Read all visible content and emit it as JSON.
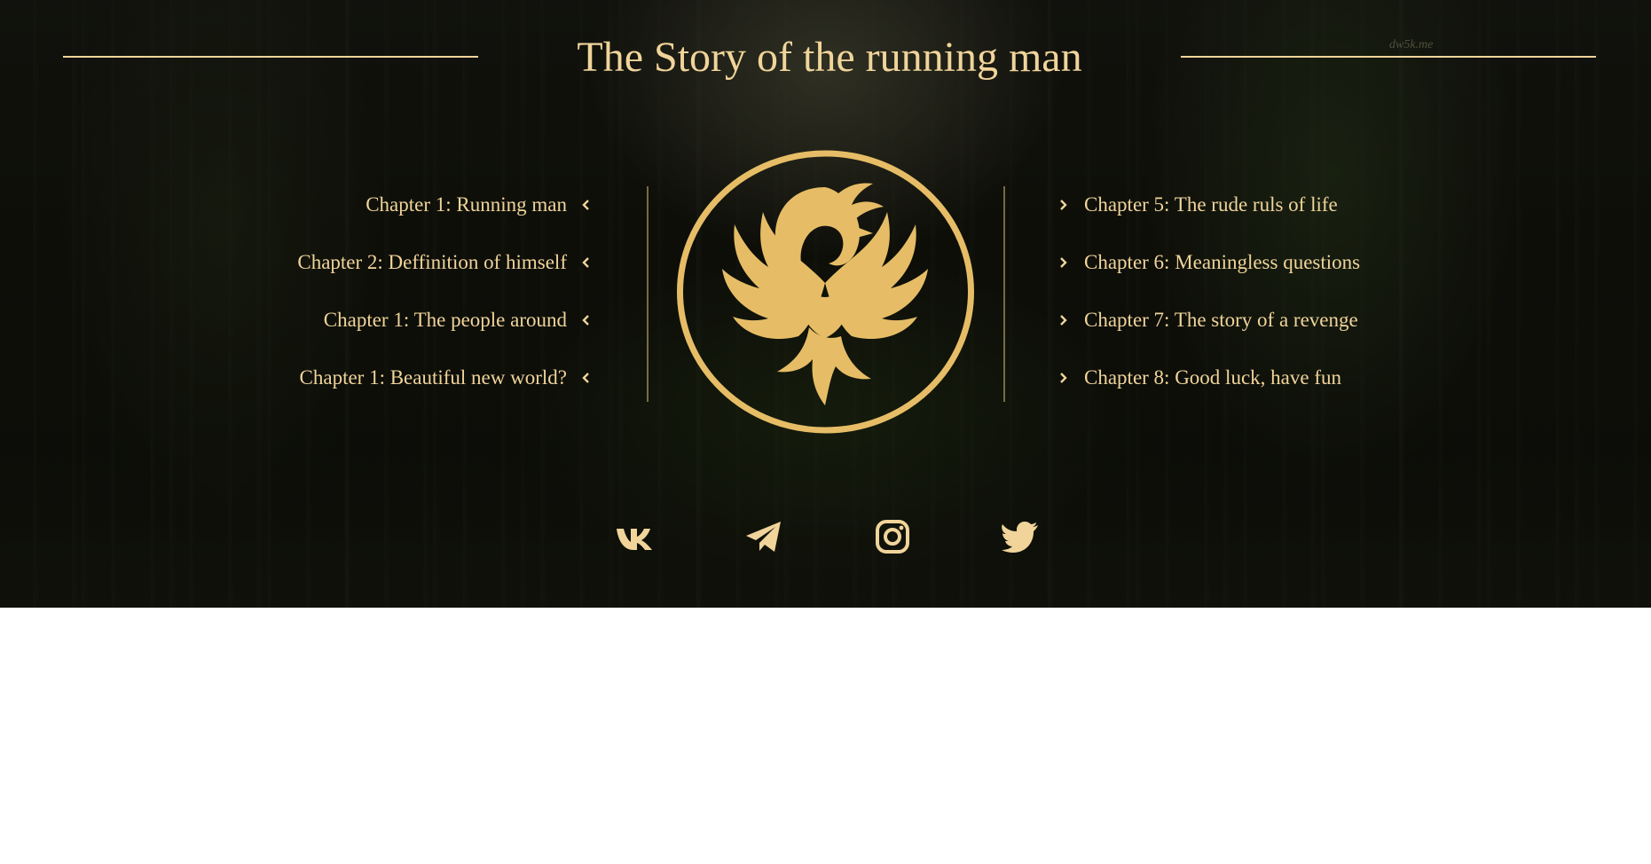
{
  "header": {
    "title": "The Story of the running man",
    "watermark": "dw5k.me"
  },
  "chapters_left": [
    {
      "label": "Chapter 1: Running man"
    },
    {
      "label": "Chapter 2: Deffinition of himself"
    },
    {
      "label": "Chapter 1: The people around"
    },
    {
      "label": "Chapter 1: Beautiful new world?"
    }
  ],
  "chapters_right": [
    {
      "label": "Chapter 5: The rude ruls of life"
    },
    {
      "label": "Chapter 6: Meaningless questions"
    },
    {
      "label": "Chapter 7: The story of a revenge"
    },
    {
      "label": "Chapter 8: Good luck, have fun"
    }
  ],
  "emblem": {
    "icon": "phoenix-emblem-icon"
  },
  "social": [
    {
      "icon": "vk-icon"
    },
    {
      "icon": "telegram-icon"
    },
    {
      "icon": "instagram-icon"
    },
    {
      "icon": "twitter-icon"
    }
  ],
  "colors": {
    "accent": "#f0d49a",
    "emblem": "#e6bd66",
    "background": "#16170f",
    "page": "#ffffff"
  }
}
